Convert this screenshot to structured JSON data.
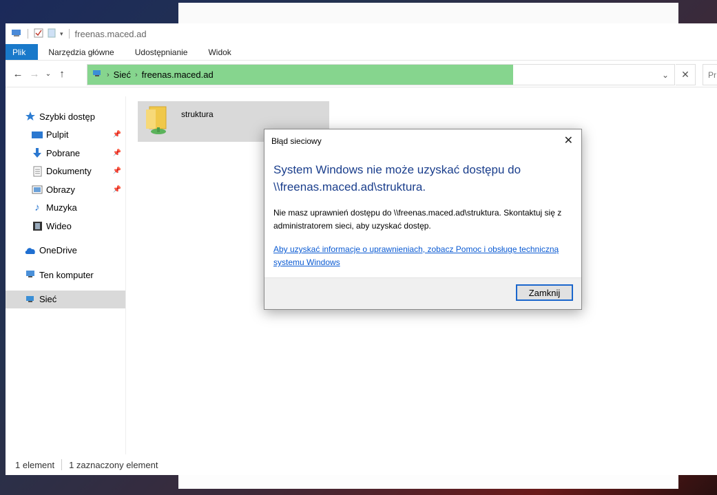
{
  "window": {
    "title": "freenas.maced.ad"
  },
  "ribbon": {
    "tabs": [
      "Plik",
      "Narzędzia główne",
      "Udostępnianie",
      "Widok"
    ]
  },
  "address": {
    "crumbs": [
      "Sieć",
      "freenas.maced.ad"
    ],
    "search_placeholder": "Pr"
  },
  "sidebar": {
    "quick_access": "Szybki dostęp",
    "pinned": [
      "Pulpit",
      "Pobrane",
      "Dokumenty",
      "Obrazy"
    ],
    "unpinned": [
      "Muzyka",
      "Wideo"
    ],
    "onedrive": "OneDrive",
    "this_pc": "Ten komputer",
    "network": "Sieć"
  },
  "content": {
    "items": [
      "struktura"
    ]
  },
  "status": {
    "count": "1 element",
    "selected": "1 zaznaczony element"
  },
  "dialog": {
    "title": "Błąd sieciowy",
    "main": "System Windows nie może uzyskać dostępu do \\\\freenas.maced.ad\\struktura.",
    "body": "Nie masz uprawnień dostępu do \\\\freenas.maced.ad\\struktura. Skontaktuj się z administratorem sieci, aby uzyskać dostęp.",
    "link": "Aby uzyskać informacje o uprawnieniach, zobacz Pomoc i obsługę techniczną systemu Windows",
    "button": "Zamknij"
  },
  "colors": {
    "accent": "#1979ca",
    "address_fill": "#86d58e",
    "dialog_heading": "#1a3e8c",
    "link": "#0b5bd3"
  }
}
